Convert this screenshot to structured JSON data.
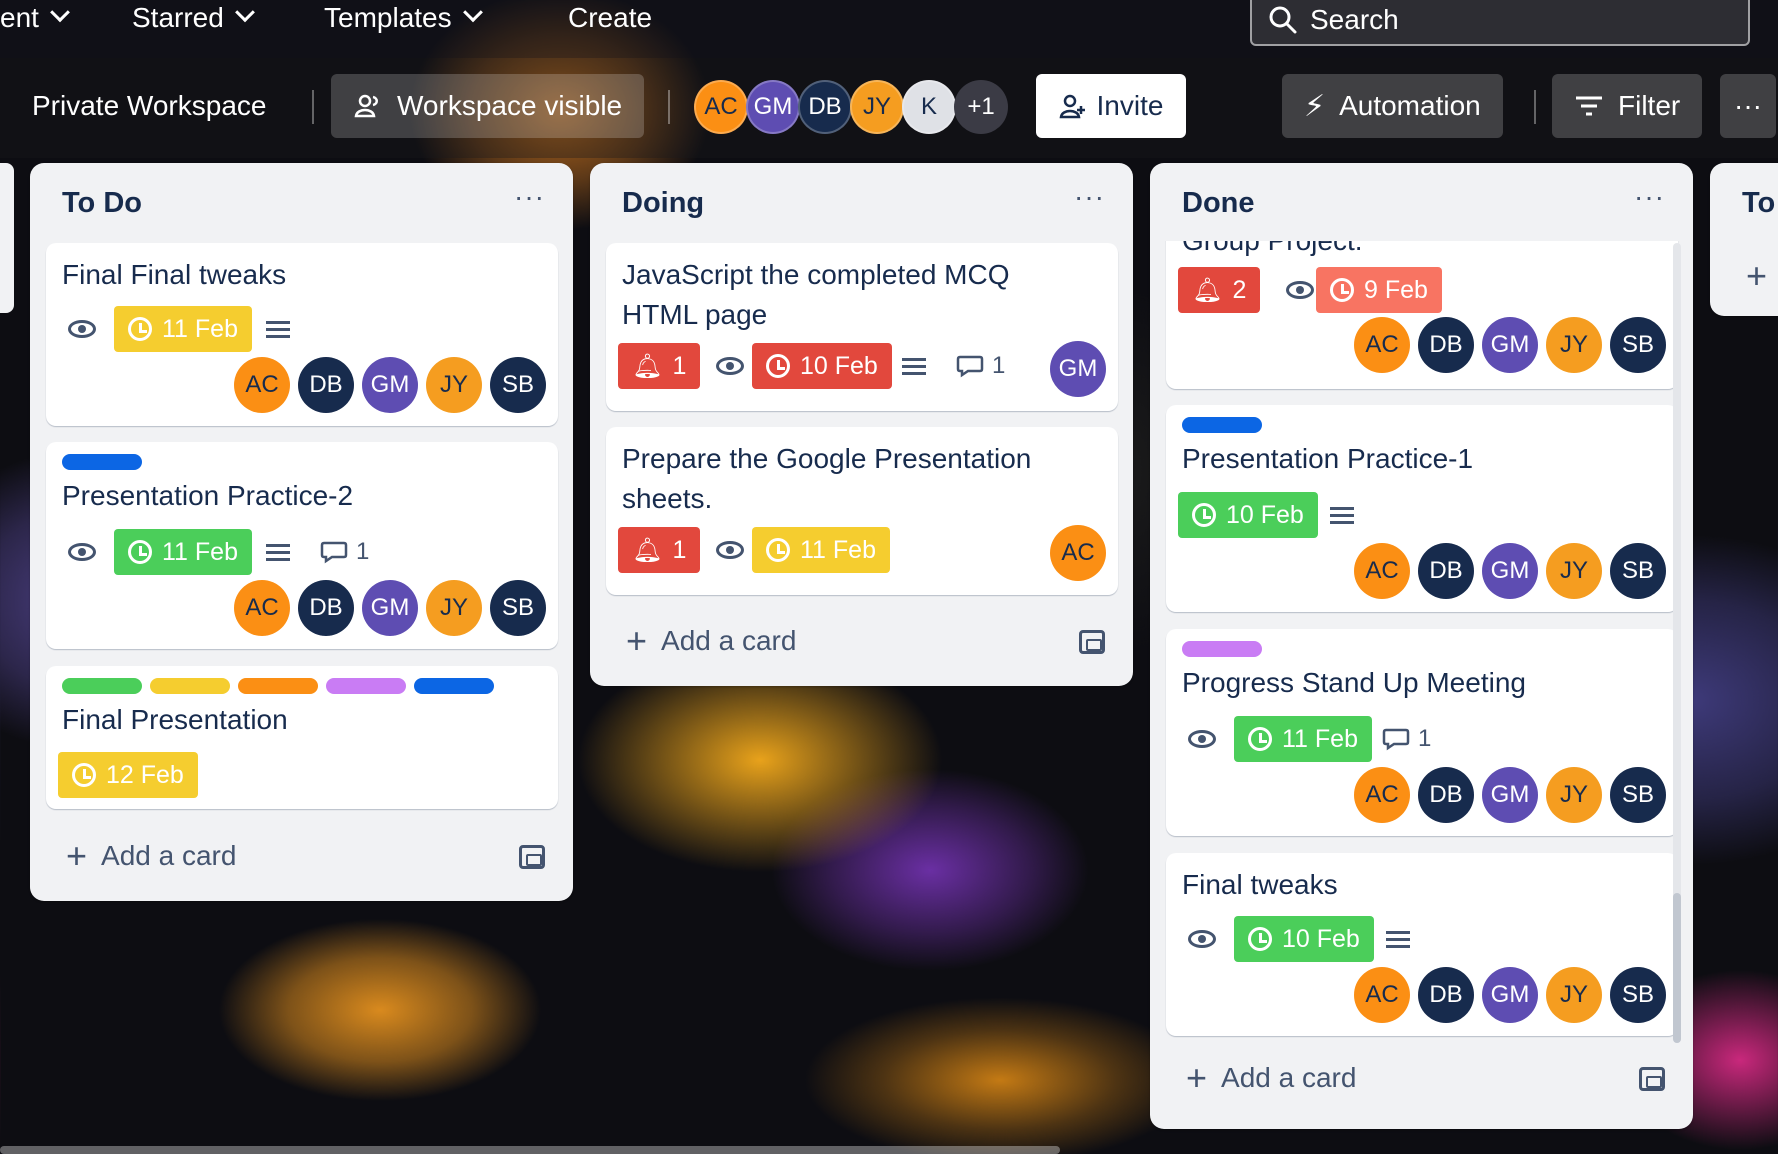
{
  "topnav": {
    "recent_label": "ent",
    "starred_label": "Starred",
    "templates_label": "Templates",
    "create_label": "Create",
    "search_placeholder": "Search"
  },
  "board_header": {
    "workspace_name": "Private Workspace",
    "visibility_label": "Workspace visible",
    "members": [
      "AC",
      "GM",
      "DB",
      "JY",
      "K"
    ],
    "extra_members": "+1",
    "invite_label": "Invite",
    "automation_label": "Automation",
    "filter_label": "Filter",
    "more_label": "···"
  },
  "lists": [
    {
      "title": "To Do",
      "menu": "···",
      "add_card": "Add a card",
      "cards": [
        {
          "title": "Final Final tweaks",
          "due": "11 Feb",
          "due_color": "#f5cd2f",
          "members": [
            "AC",
            "DB",
            "GM",
            "JY",
            "SB"
          ]
        },
        {
          "labels": [
            "#0c66e4"
          ],
          "title": "Presentation Practice-2",
          "due": "11 Feb",
          "due_color": "#4bce5a",
          "comments": "1",
          "members": [
            "AC",
            "DB",
            "GM",
            "JY",
            "SB"
          ]
        },
        {
          "labels": [
            "#4bce5a",
            "#f5cd2f",
            "#fb8f14",
            "#c97cf4",
            "#0c66e4"
          ],
          "title": "Final Presentation",
          "due": "12 Feb",
          "due_color": "#f5cd2f"
        }
      ]
    },
    {
      "title": "Doing",
      "menu": "···",
      "add_card": "Add a card",
      "cards": [
        {
          "title_line1": "JavaScript the completed MCQ",
          "title_line2": "HTML page",
          "notifications": "1",
          "due": "10 Feb",
          "due_color": "#e2483d",
          "comments": "1",
          "members": [
            "GM"
          ]
        },
        {
          "title_line1": "Prepare the Google Presentation",
          "title_line2": "sheets.",
          "notifications": "1",
          "due": "11 Feb",
          "due_color": "#f5cd2f",
          "members": [
            "AC"
          ]
        }
      ]
    },
    {
      "title": "Done",
      "menu": "···",
      "add_card": "Add a card",
      "cards": [
        {
          "title_partial": "Group Project.",
          "notifications": "2",
          "due": "9 Feb",
          "due_color": "#f87462",
          "members": [
            "AC",
            "DB",
            "GM",
            "JY",
            "SB"
          ]
        },
        {
          "labels": [
            "#0c66e4"
          ],
          "title": "Presentation Practice-1",
          "due": "10 Feb",
          "due_color": "#4bce5a",
          "members": [
            "AC",
            "DB",
            "GM",
            "JY",
            "SB"
          ]
        },
        {
          "labels": [
            "#c97cf4"
          ],
          "title": "Progress Stand Up Meeting",
          "due": "11 Feb",
          "due_color": "#4bce5a",
          "comments": "1",
          "members": [
            "AC",
            "DB",
            "GM",
            "JY",
            "SB"
          ]
        },
        {
          "title": "Final tweaks",
          "due": "10 Feb",
          "due_color": "#4bce5a",
          "members": [
            "AC",
            "DB",
            "GM",
            "JY",
            "SB"
          ]
        }
      ]
    },
    {
      "title": "To"
    }
  ]
}
